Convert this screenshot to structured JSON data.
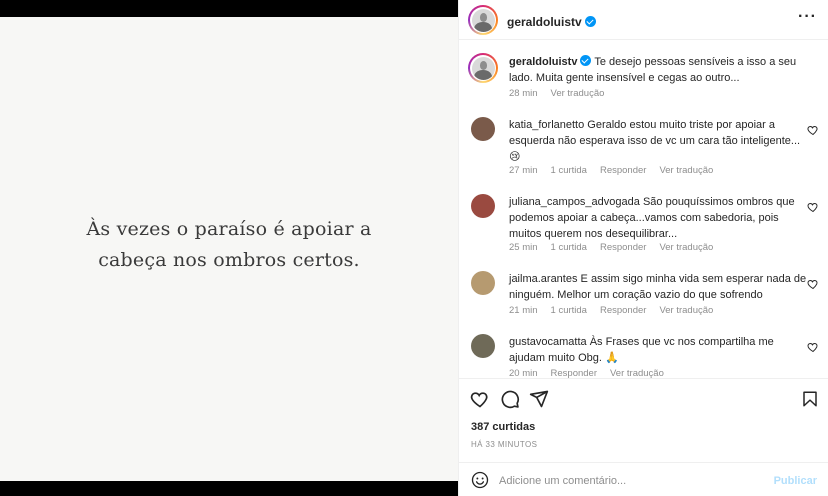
{
  "post": {
    "quote": "Às vezes o paraíso é apoiar a cabeça nos ombros certos."
  },
  "header": {
    "username": "geraldoluistv",
    "more_icon": "more-horizontal-icon"
  },
  "caption": {
    "username": "geraldoluistv",
    "text": "Te desejo pessoas sensíveis a isso a seu lado. Muita gente insensível e cegas ao outro...",
    "time": "28 min",
    "translate": "Ver tradução"
  },
  "comments": [
    {
      "username": "katia_forlanetto",
      "text": "Geraldo estou muito triste por apoiar a esquerda não esperava isso de vc um cara tão inteligente... 😢",
      "time": "27 min",
      "likes": "1 curtida",
      "reply": "Responder",
      "translate": "Ver tradução",
      "avatar_color": "#7a5a4a"
    },
    {
      "username": "juliana_campos_advogada",
      "text": "São pouquíssimos ombros que podemos apoiar a cabeça...vamos com sabedoria, pois muitos querem nos desequilibrar...",
      "time": "25 min",
      "likes": "1 curtida",
      "reply": "Responder",
      "translate": "Ver tradução",
      "avatar_color": "#9a4a40"
    },
    {
      "username": "jailma.arantes",
      "text": "E assim sigo minha vida sem esperar nada de ninguém. Melhor um coração vazio do que sofrendo",
      "time": "21 min",
      "likes": "1 curtida",
      "reply": "Responder",
      "translate": "Ver tradução",
      "avatar_color": "#b69a70"
    },
    {
      "username": "gustavocamatta",
      "text": "Às Frases que vc nos compartilha me ajudam muito Obg. 🙏",
      "time": "20 min",
      "likes": "",
      "reply": "Responder",
      "translate": "Ver tradução",
      "avatar_color": "#6f6a58"
    }
  ],
  "actions": {
    "likes": "387 curtidas",
    "posted": "HÁ 33 MINUTOS",
    "icons": [
      "heart-icon",
      "comment-icon",
      "share-icon",
      "bookmark-icon"
    ]
  },
  "add_comment": {
    "placeholder": "Adicione um comentário...",
    "publish": "Publicar",
    "emoji_icon": "emoji-icon"
  },
  "colors": {
    "accent": "#0095f6",
    "muted": "#8e8e8e",
    "publish_disabled": "#b2dffc"
  }
}
